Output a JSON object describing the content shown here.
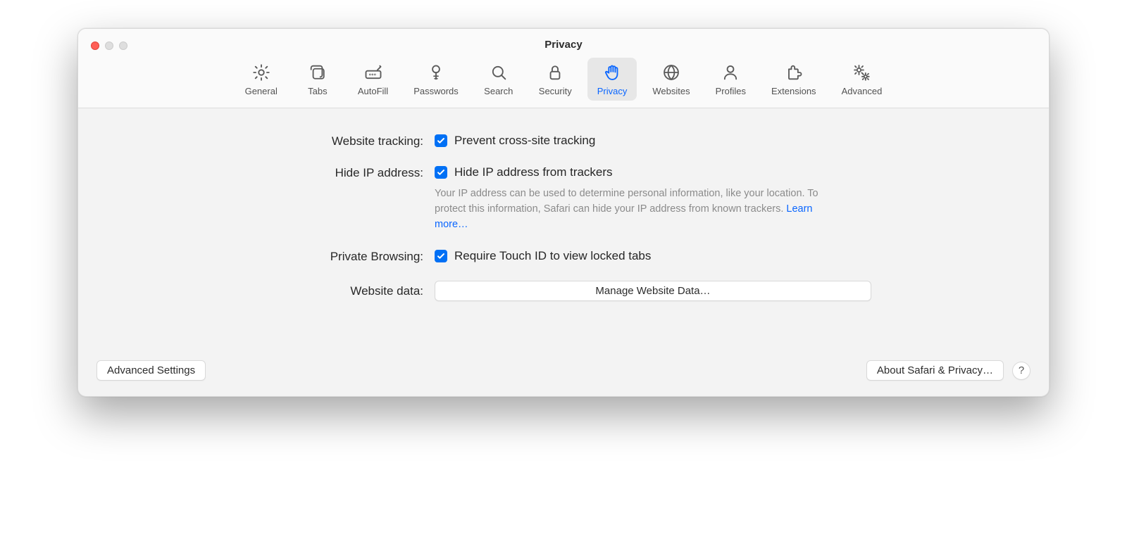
{
  "window": {
    "title": "Privacy"
  },
  "toolbar": {
    "items": [
      {
        "id": "general",
        "label": "General"
      },
      {
        "id": "tabs",
        "label": "Tabs"
      },
      {
        "id": "autofill",
        "label": "AutoFill"
      },
      {
        "id": "passwords",
        "label": "Passwords"
      },
      {
        "id": "search",
        "label": "Search"
      },
      {
        "id": "security",
        "label": "Security"
      },
      {
        "id": "privacy",
        "label": "Privacy",
        "active": true
      },
      {
        "id": "websites",
        "label": "Websites"
      },
      {
        "id": "profiles",
        "label": "Profiles"
      },
      {
        "id": "extensions",
        "label": "Extensions"
      },
      {
        "id": "advanced",
        "label": "Advanced"
      }
    ]
  },
  "settings": {
    "website_tracking": {
      "label": "Website tracking:",
      "checkbox_label": "Prevent cross-site tracking",
      "checked": true
    },
    "hide_ip": {
      "label": "Hide IP address:",
      "checkbox_label": "Hide IP address from trackers",
      "checked": true,
      "help_text": "Your IP address can be used to determine personal information, like your location. To protect this information, Safari can hide your IP address from known trackers.",
      "learn_more": "Learn more…"
    },
    "private_browsing": {
      "label": "Private Browsing:",
      "checkbox_label": "Require Touch ID to view locked tabs",
      "checked": true
    },
    "website_data": {
      "label": "Website data:",
      "button_label": "Manage Website Data…"
    }
  },
  "footer": {
    "advanced_settings": "Advanced Settings",
    "about": "About Safari & Privacy…",
    "help": "?"
  }
}
